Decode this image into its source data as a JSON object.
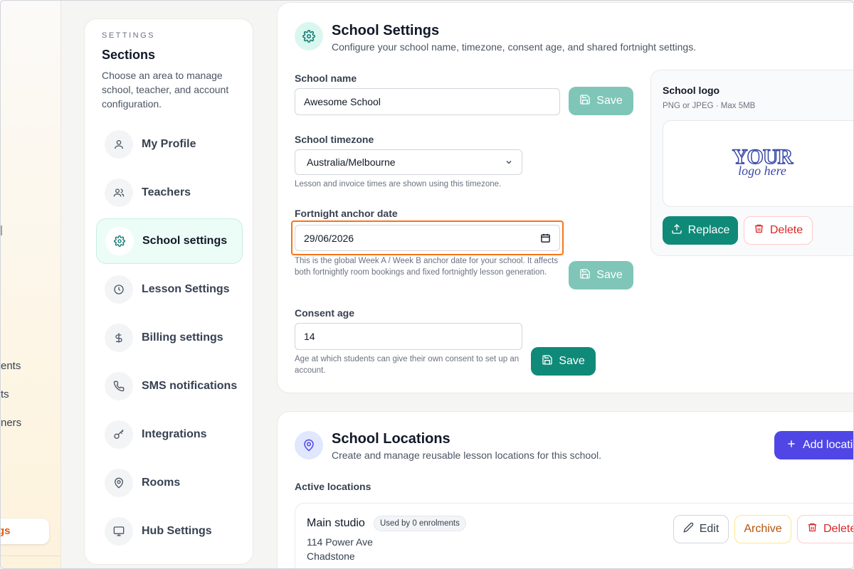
{
  "app_sidebar": {
    "fragments": [
      "s",
      "ents",
      "ts",
      "ners"
    ],
    "active_fragment": "gs"
  },
  "sections": {
    "eyebrow": "SETTINGS",
    "title": "Sections",
    "description": "Choose an area to manage school, teacher, and account configuration.",
    "items": [
      {
        "label": "My Profile",
        "icon": "user-icon"
      },
      {
        "label": "Teachers",
        "icon": "users-icon"
      },
      {
        "label": "School settings",
        "icon": "gear-icon",
        "active": true
      },
      {
        "label": "Lesson Settings",
        "icon": "clock-icon"
      },
      {
        "label": "Billing settings",
        "icon": "dollar-icon"
      },
      {
        "label": "SMS notifications",
        "icon": "phone-icon"
      },
      {
        "label": "Integrations",
        "icon": "key-icon"
      },
      {
        "label": "Rooms",
        "icon": "map-pin-icon"
      },
      {
        "label": "Hub Settings",
        "icon": "monitor-icon"
      }
    ]
  },
  "school_settings": {
    "title": "School Settings",
    "subtitle": "Configure your school name, timezone, consent age, and shared fortnight settings.",
    "school_name": {
      "label": "School name",
      "value": "Awesome School",
      "save": "Save"
    },
    "timezone": {
      "label": "School timezone",
      "value": "Australia/Melbourne",
      "hint": "Lesson and invoice times are shown using this timezone."
    },
    "anchor": {
      "label": "Fortnight anchor date",
      "value": "29/06/2026",
      "hint": "This is the global Week A / Week B anchor date for your school. It affects both fortnightly room bookings and fixed fortnightly lesson generation.",
      "save": "Save"
    },
    "consent": {
      "label": "Consent age",
      "value": "14",
      "hint": "Age at which students can give their own consent to set up an account.",
      "save": "Save"
    },
    "logo": {
      "title": "School logo",
      "subtitle": "PNG or JPEG · Max 5MB",
      "placeholder_top": "YOUR",
      "placeholder_bottom": "logo here",
      "replace": "Replace",
      "delete": "Delete"
    }
  },
  "locations": {
    "title": "School Locations",
    "subtitle": "Create and manage reusable lesson locations for this school.",
    "add_button": "Add location",
    "active_label": "Active locations",
    "rows": [
      {
        "name": "Main studio",
        "badge": "Used by 0 enrolments",
        "address1": "114 Power Ave",
        "address2": "Chadstone",
        "edit": "Edit",
        "archive": "Archive",
        "delete": "Delete"
      }
    ]
  },
  "colors": {
    "accent": "#0f8a78",
    "focus": "#f97316",
    "indigo": "#4f46e5",
    "danger": "#dc2626"
  }
}
